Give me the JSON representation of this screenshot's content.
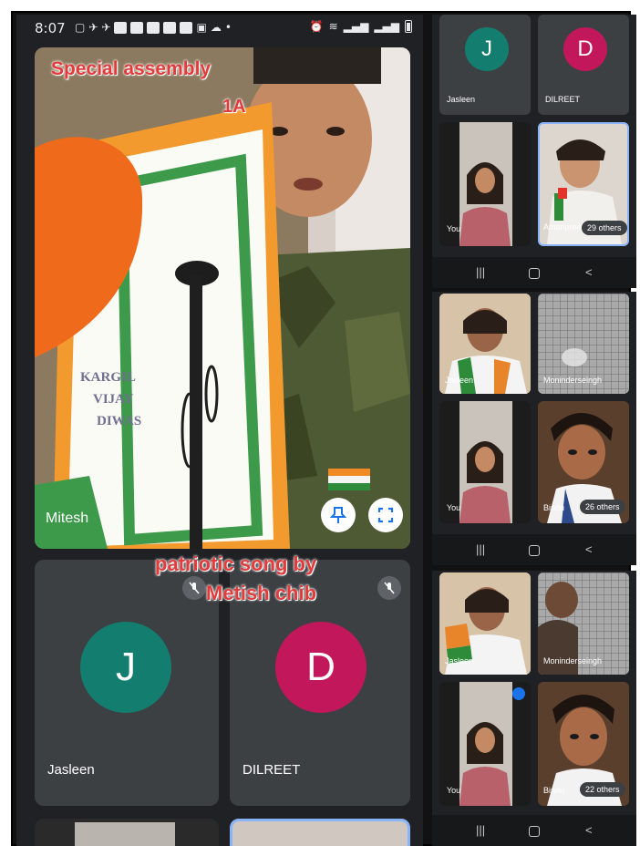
{
  "status_bar": {
    "time": "8:07"
  },
  "overlay": {
    "line1": "Special assembly",
    "line2": "1A",
    "line3": "patriotic song by",
    "line4": "Metish chib"
  },
  "main": {
    "presenter_name": "Mitesh",
    "poster_text": [
      "KARGIL",
      "VIJAY",
      "DIWAS"
    ],
    "tiles": [
      {
        "initial": "J",
        "name": "Jasleen",
        "color": "#137e6f"
      },
      {
        "initial": "D",
        "name": "DILREET",
        "color": "#c2185b"
      }
    ]
  },
  "screen2": {
    "tiles": [
      {
        "initial": "J",
        "name": "Jasleen",
        "color": "#137e6f"
      },
      {
        "initial": "D",
        "name": "DILREET",
        "color": "#c2185b"
      }
    ],
    "you_label": "You",
    "other_name": "Amanpreet",
    "others_count": "29 others"
  },
  "screen3": {
    "tile1_name": "Jasleen",
    "tile2_name": "Moninderseingh",
    "you_label": "You",
    "tile4_name": "Bindu",
    "others_count": "26 others"
  },
  "screen4": {
    "tile1_name": "Jasleen",
    "tile2_name": "Moninderseingh",
    "you_label": "You",
    "tile4_name": "Bindu",
    "others_count": "22 others"
  },
  "nav": {
    "recent": "|||",
    "back": "<"
  }
}
